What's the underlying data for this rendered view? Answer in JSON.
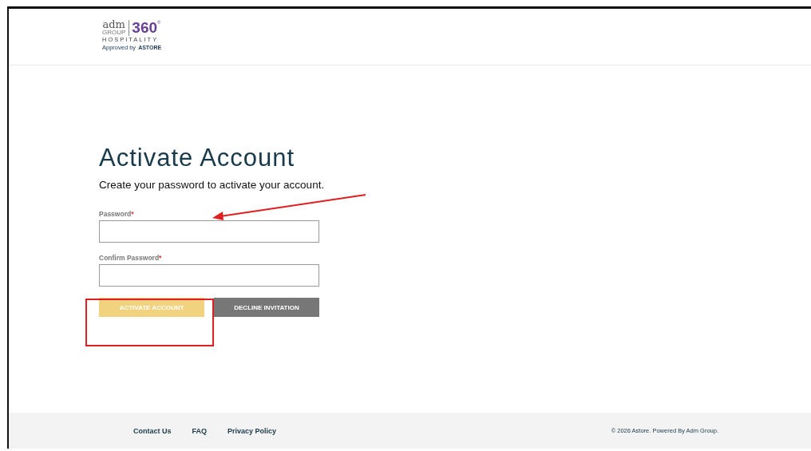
{
  "logo": {
    "brand": "adm",
    "group": "GROUP",
    "number": "360",
    "registered": "®",
    "line": "HOSPITALITY",
    "approved": "Approved by",
    "partner": "ASTORE"
  },
  "heading": "Activate Account",
  "subtitle": "Create your password to activate your account.",
  "fields": [
    {
      "label": "Password",
      "required_mark": "*"
    },
    {
      "label": "Confirm Password",
      "required_mark": "*"
    }
  ],
  "buttons": [
    {
      "label": "ACTIVATE ACCOUNT",
      "kind": "primary",
      "disabled": true
    },
    {
      "label": "DECLINE INVITATION",
      "kind": "secondary",
      "disabled": false
    }
  ],
  "footer": {
    "links": [
      "Contact Us",
      "FAQ",
      "Privacy Policy"
    ],
    "copyright": "© 2026 Astore. Powered By Adm Group."
  }
}
